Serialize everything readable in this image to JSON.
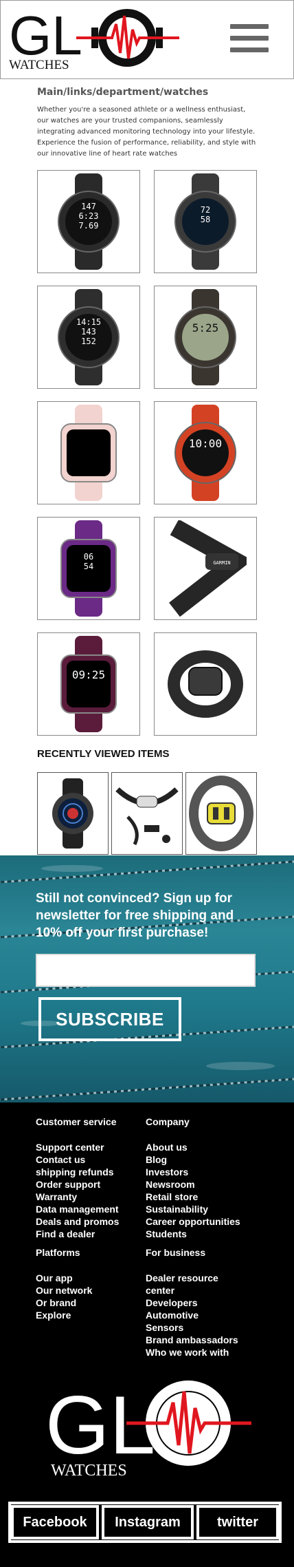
{
  "header": {
    "logo": {
      "letters": "GL",
      "wordmark": "WATCHES",
      "icon": "heartbeat-o-icon"
    },
    "menu_icon": "hamburger-menu-icon"
  },
  "breadcrumb": "Main/links/department/watches",
  "intro": "Whether you're a seasoned athlete or a wellness enthusiast,  our watches are your trusted companions, seamlessly integrating advanced monitoring technology into your lifestyle. Experience the fusion of performance, reliability,  and style with our innovative line of heart rate watches",
  "products": [
    {
      "name": "black-sport-watch",
      "screen_text": [
        "147",
        "6:23",
        "7.69"
      ],
      "colors": {
        "body": "#2a2a2a",
        "screen": "#111"
      }
    },
    {
      "name": "gray-running-watch",
      "screen_text": [
        "72",
        "58"
      ],
      "colors": {
        "body": "#3a3a3a",
        "screen": "#0c1b2a"
      }
    },
    {
      "name": "charcoal-fitness-watch",
      "screen_text": [
        "14:15",
        "143",
        "152"
      ],
      "colors": {
        "body": "#2e2e2e",
        "screen": "#111"
      }
    },
    {
      "name": "digital-lcd-watch",
      "screen_text": [
        "5:25"
      ],
      "colors": {
        "body": "#3b3530",
        "screen": "#9aa58a"
      }
    },
    {
      "name": "pink-smart-watch",
      "screen_text": [],
      "colors": {
        "body": "#f2d3cf",
        "screen": "#000"
      }
    },
    {
      "name": "red-outdoor-watch",
      "screen_text": [
        "10:00"
      ],
      "colors": {
        "body": "#d44224",
        "screen": "#111"
      }
    },
    {
      "name": "purple-fitness-band",
      "screen_text": [
        "06",
        "54"
      ],
      "colors": {
        "body": "#6b2a86",
        "screen": "#000"
      }
    },
    {
      "name": "chest-strap-monitor",
      "screen_text": [
        "GARMIN"
      ],
      "colors": {
        "body": "#262626",
        "screen": "#111"
      }
    },
    {
      "name": "plum-smart-watch",
      "screen_text": [
        "09:25"
      ],
      "colors": {
        "body": "#5a1c3a",
        "screen": "#000"
      }
    },
    {
      "name": "armband-monitor",
      "screen_text": [],
      "colors": {
        "body": "#2b2b2b",
        "screen": "#111"
      }
    }
  ],
  "recent": {
    "title": "RECENTLY VIEWED ITEMS",
    "items": [
      {
        "name": "round-black-watch"
      },
      {
        "name": "chest-strap-kit"
      },
      {
        "name": "yellow-armband"
      }
    ]
  },
  "newsletter": {
    "text": "Still not convinced? Sign up for newsletter for free shipping and 10% off your first purchase!",
    "input_placeholder": "",
    "subscribe_label": "SUBSCRIBE"
  },
  "footer": {
    "customer_service": {
      "title": "Customer service",
      "links": [
        "Support center",
        "Contact us",
        "shipping refunds",
        "Order support",
        "Warranty",
        "Data management",
        "Deals and promos",
        "Find a dealer"
      ]
    },
    "company": {
      "title": "Company",
      "links": [
        "About us",
        "Blog",
        "Investors",
        "Newsroom",
        "Retail store",
        "Sustainability",
        "Career opportunities",
        "Students"
      ]
    },
    "platforms": {
      "title": "Platforms",
      "links": [
        "Our app",
        "Our network",
        "Or brand",
        "Explore"
      ]
    },
    "business": {
      "title": "For business",
      "links": [
        "Dealer resource",
        "center",
        "Developers",
        "Automotive",
        "Sensors",
        "Brand ambassadors",
        "Who we work with"
      ]
    },
    "logo": {
      "letters": "GL",
      "wordmark": "WATCHES"
    },
    "social": [
      "Facebook",
      "Instagram",
      "twitter"
    ]
  },
  "colors": {
    "accent": "#e0161f",
    "footer_bg": "#000000",
    "newsletter_water": "#1f7a8c"
  }
}
